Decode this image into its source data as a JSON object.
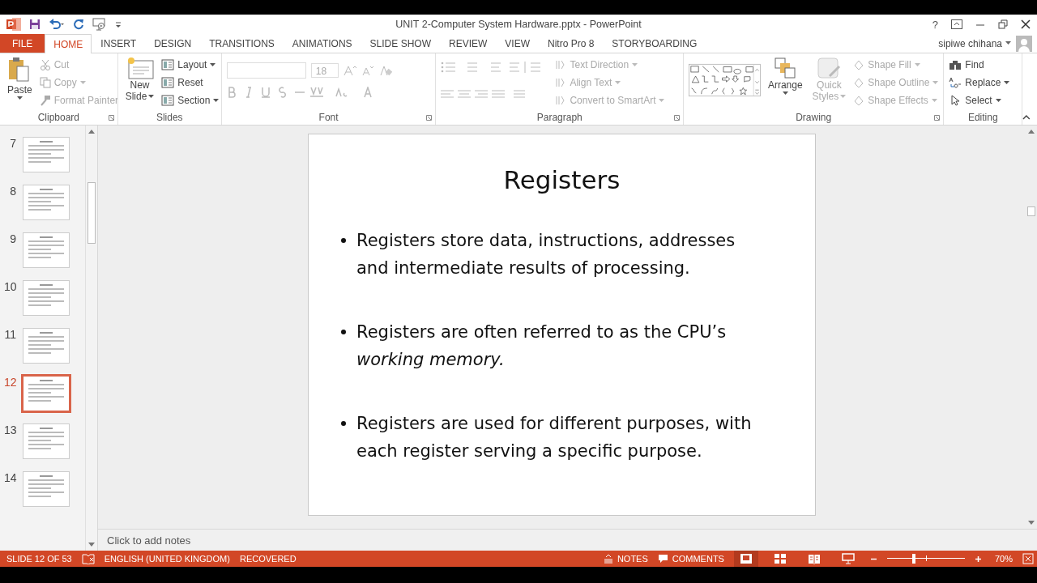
{
  "window": {
    "title": "UNIT 2-Computer System Hardware.pptx - PowerPoint",
    "help": "?",
    "user": "sipiwe chihana"
  },
  "tabs": [
    {
      "label": "FILE",
      "kind": "file",
      "selected": false
    },
    {
      "label": "HOME",
      "kind": "tab",
      "selected": true
    },
    {
      "label": "INSERT",
      "kind": "tab",
      "selected": false
    },
    {
      "label": "DESIGN",
      "kind": "tab",
      "selected": false
    },
    {
      "label": "TRANSITIONS",
      "kind": "tab",
      "selected": false
    },
    {
      "label": "ANIMATIONS",
      "kind": "tab",
      "selected": false
    },
    {
      "label": "SLIDE SHOW",
      "kind": "tab",
      "selected": false
    },
    {
      "label": "REVIEW",
      "kind": "tab",
      "selected": false
    },
    {
      "label": "VIEW",
      "kind": "tab",
      "selected": false
    },
    {
      "label": "Nitro Pro 8",
      "kind": "tab",
      "selected": false
    },
    {
      "label": "STORYBOARDING",
      "kind": "tab",
      "selected": false
    }
  ],
  "ribbon": {
    "clipboard": {
      "label": "Clipboard",
      "paste": "Paste",
      "items": [
        {
          "label": "Cut",
          "disabled": true
        },
        {
          "label": "Copy",
          "disabled": true
        },
        {
          "label": "Format Painter",
          "disabled": true
        }
      ]
    },
    "slides": {
      "label": "Slides",
      "new_slide": [
        "New",
        "Slide"
      ],
      "items": [
        {
          "label": "Layout"
        },
        {
          "label": "Reset"
        },
        {
          "label": "Section"
        }
      ]
    },
    "font": {
      "label": "Font",
      "font_size": "18",
      "disabled": true
    },
    "paragraph": {
      "label": "Paragraph",
      "items": [
        {
          "label": "Text Direction",
          "disabled": true
        },
        {
          "label": "Align Text",
          "disabled": true
        },
        {
          "label": "Convert to SmartArt",
          "disabled": true
        }
      ]
    },
    "drawing": {
      "label": "Drawing",
      "arrange": "Arrange",
      "quick_styles": [
        "Quick",
        "Styles"
      ],
      "items": [
        {
          "label": "Shape Fill",
          "disabled": true
        },
        {
          "label": "Shape Outline",
          "disabled": true
        },
        {
          "label": "Shape Effects",
          "disabled": true
        }
      ]
    },
    "editing": {
      "label": "Editing",
      "items": [
        {
          "label": "Find"
        },
        {
          "label": "Replace"
        },
        {
          "label": "Select"
        }
      ]
    }
  },
  "thumbnails": [
    {
      "number": "7",
      "selected": false
    },
    {
      "number": "8",
      "selected": false
    },
    {
      "number": "9",
      "selected": false
    },
    {
      "number": "10",
      "selected": false
    },
    {
      "number": "11",
      "selected": false
    },
    {
      "number": "12",
      "selected": true
    },
    {
      "number": "13",
      "selected": false
    },
    {
      "number": "14",
      "selected": false
    }
  ],
  "slide": {
    "title": "Registers",
    "bullets": [
      "Registers store data, instructions, addresses and intermediate results of processing.",
      "Registers are often referred to as the CPU’s *working memory.*",
      "Registers are used for different purposes, with each register serving a specific purpose."
    ]
  },
  "notes": {
    "placeholder": "Click to add notes"
  },
  "status_bar": {
    "slide": "SLIDE 12 OF 53",
    "language": "ENGLISH (UNITED KINGDOM)",
    "state": "RECOVERED",
    "notes": "NOTES",
    "comments": "COMMENTS",
    "views": [
      {
        "kind": "normal",
        "selected": true
      },
      {
        "kind": "sorter",
        "selected": false
      },
      {
        "kind": "reading",
        "selected": false
      },
      {
        "kind": "show",
        "selected": false
      }
    ],
    "zoom": {
      "level": 0.34,
      "reading": "70%"
    }
  }
}
